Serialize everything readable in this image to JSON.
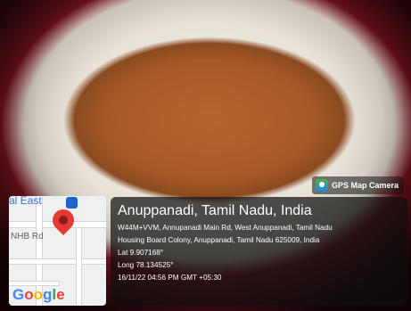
{
  "badge": {
    "label": "GPS Map Camera",
    "icon": "gps-map-camera-icon"
  },
  "map": {
    "label_top": "al East",
    "label_road": "NHB Rd",
    "brand": [
      "G",
      "o",
      "o",
      "g",
      "l",
      "e"
    ],
    "pin_icon": "location-pin-icon",
    "transit_icon": "bus-stop-icon"
  },
  "location": {
    "title": "Anuppanadi, Tamil Nadu, India",
    "address_line1": "W44M+VVM, Annupanadi Main Rd, West Anuppanadi, Tamil Nadu",
    "address_line2": "Housing Board Colony, Anuppanadi, Tamil Nadu 625009, India",
    "lat": "Lat 9.907168°",
    "long": "Long 78.134525°",
    "timestamp": "16/11/22 04:56 PM GMT +05:30"
  },
  "colors": {
    "pin": "#e53935",
    "panel_bg": "rgba(15,15,15,0.72)"
  }
}
